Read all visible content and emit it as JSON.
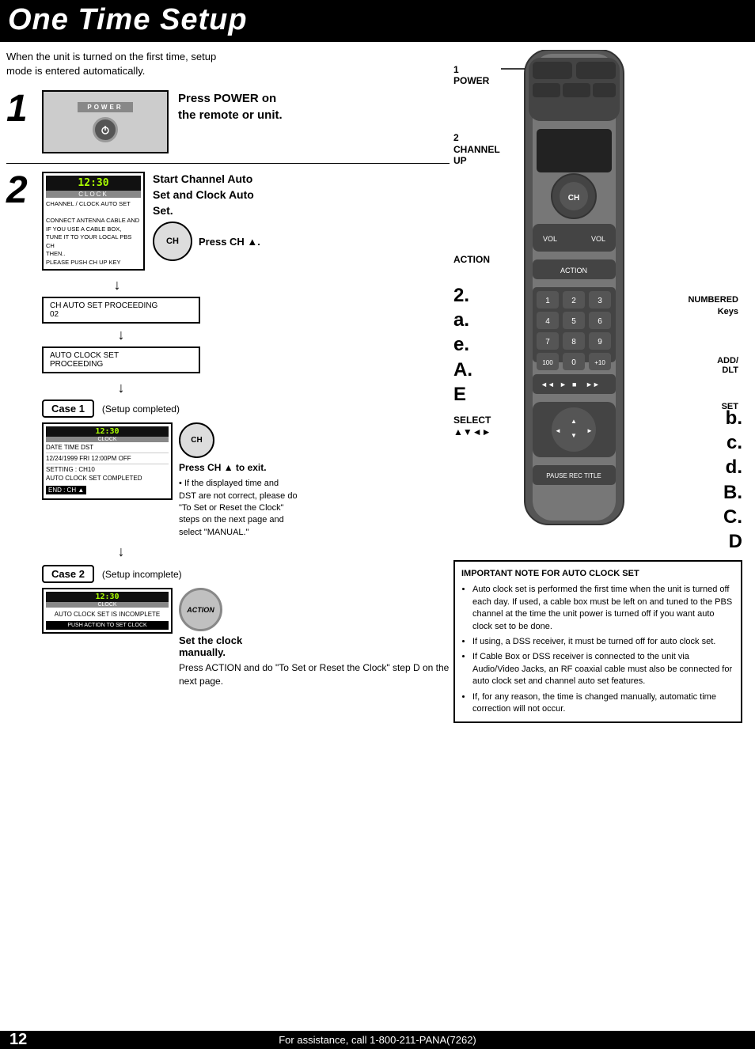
{
  "header": {
    "title": "One Time Setup"
  },
  "intro": {
    "text": "When the unit is turned on the first time, setup\nmode is entered automatically."
  },
  "step1": {
    "number": "1",
    "image_label": "POWER",
    "instruction": "Press POWER on\nthe remote or unit."
  },
  "step2": {
    "number": "2",
    "title": "Start Channel Auto\nSet and Clock Auto\nSet.",
    "press_ch": "Press CH ▲.",
    "clock_display": "12:30",
    "clock_label": "CLOCK",
    "clock_text": "CHANNEL / CLOCK  AUTO SET\n\nCONNECT  ANTENNA  CABLE  AND\nIF YOU  USE  A  CABLE  BOX,\nTUNE  IT  TO  YOUR  LOCAL  PBS  CH\nTHEN..\nPLEASE  PUSH  CH  UP  KEY",
    "ch_button": "CH",
    "auto_set_text1": "CH AUTO SET PROCEEDING\n02",
    "auto_set_text2": "AUTO CLOCK SET\nPROCEEDING"
  },
  "case1": {
    "label": "Case 1",
    "desc": "(Setup completed)",
    "screen_clock": "12:30",
    "screen_label": "CLOCK",
    "screen_date": "DATE        TIME   DST",
    "screen_date2": "12/24/1999  FRI  12:00PM  OFF",
    "screen_setting": "SETTING  :  CH10",
    "screen_status": "AUTO CLOCK  SET  COMPLETED",
    "screen_end": "END : CH ▲",
    "ch_button": "CH",
    "instruction": "Press CH ▲ to exit.",
    "bullet": "• If the displayed time and DST are not correct, please do \"To Set or Reset the Clock\" steps on the next page and select \"MANUAL.\""
  },
  "case2": {
    "label": "Case 2",
    "desc": "(Setup incomplete)",
    "screen_clock": "12:30",
    "screen_label": "CLOCK",
    "screen_text": "AUTO CLOCK SET IS INCOMPLETE",
    "screen_button": "PUSH ACTION TO SET CLOCK",
    "action_text": "AcTION",
    "instruction_bold": "Set the clock\nmanually.",
    "instruction": "Press ACTION\nand do \"To Set\nor Reset the\nClock\" step D on\nthe next page."
  },
  "remote": {
    "label1_text": "1\nPOWER",
    "label2_text": "2\nCHANNEL\nUP",
    "label_action": "ACTION",
    "label_select": "SELECT\n▲▼◄►",
    "label_numbered": "NUMBERED\nKeys",
    "label_add_dlt": "ADD/\nDLT",
    "label_set": "SET",
    "side_letters": "b.\nc.\nd.\nB.\nC.\nD"
  },
  "important_note": {
    "title": "IMPORTANT NOTE FOR AUTO CLOCK SET",
    "bullets": [
      "Auto clock set is performed the first time when the unit is turned off each day. If used, a cable box must be left on and tuned to the PBS channel at the time the unit power is turned off if you want auto clock set to be done.",
      "If using, a DSS receiver, it must be turned off for auto clock set.",
      "If Cable Box or DSS receiver is connected to the unit via Audio/Video Jacks, an RF coaxial cable must also be connected for auto clock set and channel auto set features.",
      "If, for any reason, the time is changed manually, automatic time correction will not occur."
    ]
  },
  "footer": {
    "page": "12",
    "text": "For assistance, call 1-800-211-PANA(7262)"
  }
}
